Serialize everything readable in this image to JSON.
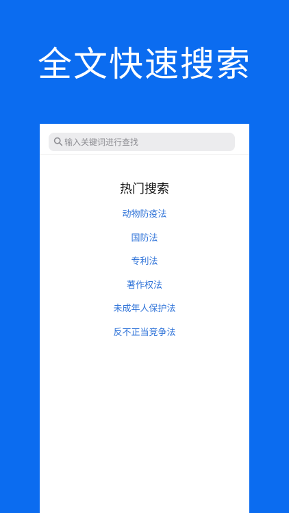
{
  "hero": {
    "title": "全文快速搜索"
  },
  "search": {
    "placeholder": "输入关键词进行查找",
    "icon": "search-icon"
  },
  "hot": {
    "title": "热门搜索",
    "items": [
      "动物防疫法",
      "国防法",
      "专利法",
      "著作权法",
      "未成年人保护法",
      "反不正当竞争法"
    ]
  },
  "colors": {
    "background": "#0b6cf0",
    "link": "#2f73d8",
    "search_box": "#ececee"
  }
}
